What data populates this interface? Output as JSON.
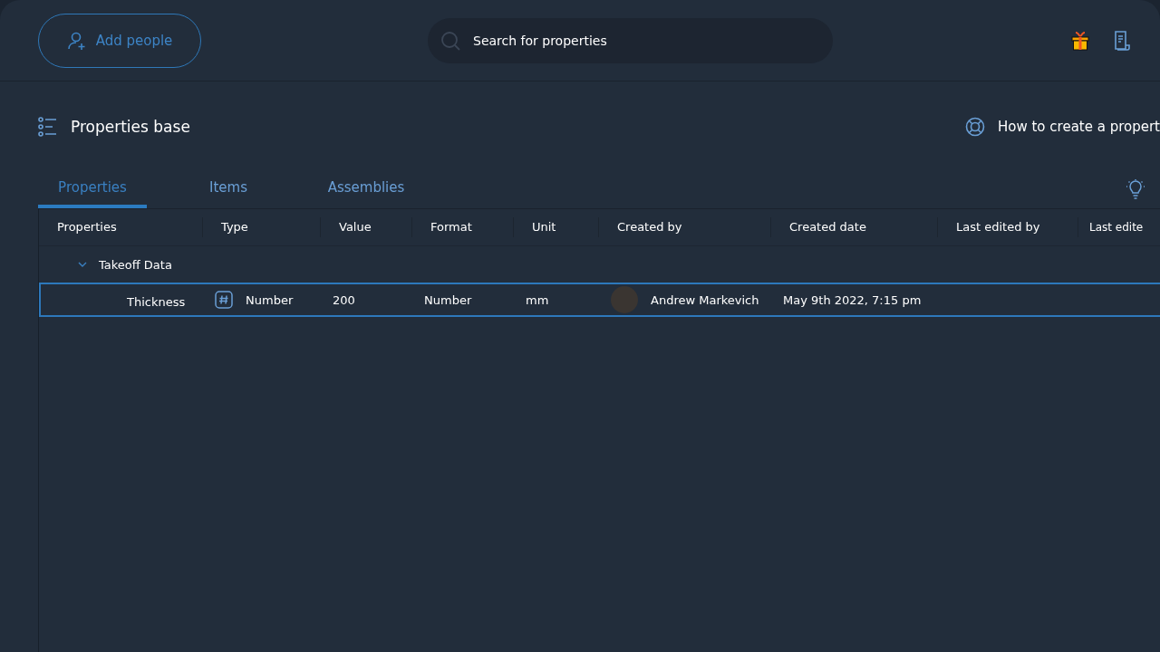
{
  "header": {
    "add_people": "Add people",
    "search": {
      "placeholder": "Search for properties"
    }
  },
  "page": {
    "title": "Properties base",
    "help_link": "How to create a propert"
  },
  "tabs": [
    {
      "label": "Properties",
      "selected": true
    },
    {
      "label": "Items",
      "selected": false
    },
    {
      "label": "Assemblies",
      "selected": false
    }
  ],
  "table": {
    "columns": [
      "Properties",
      "Type",
      "Value",
      "Format",
      "Unit",
      "Created by",
      "Created date",
      "Last edited by",
      "Last edite"
    ],
    "groups": [
      {
        "name": "Takeoff Data",
        "expanded": true,
        "children": [
          {
            "name": "Thickness",
            "type": "Number",
            "value": "200",
            "format": "Number",
            "unit": "mm",
            "created_by": "Andrew Markevich",
            "created_date": "May 9th 2022, 7:15 pm",
            "selected": true
          }
        ]
      }
    ]
  }
}
